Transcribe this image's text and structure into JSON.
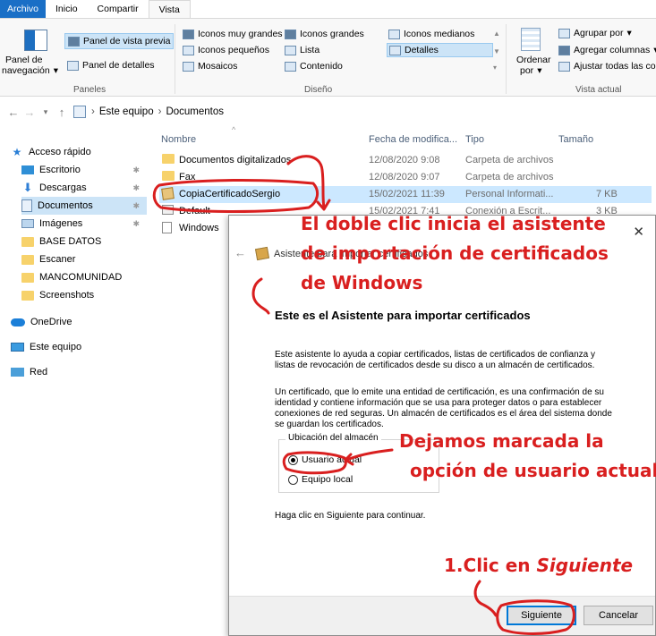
{
  "ribbon_tabs": [
    "Archivo",
    "Inicio",
    "Compartir",
    "Vista"
  ],
  "ribbon": {
    "panes": {
      "nav_pane": "Panel de",
      "nav_pane2": "navegación",
      "preview_pane": "Panel de vista previa",
      "details_pane": "Panel de detalles",
      "label": "Paneles"
    },
    "layout": {
      "items": [
        "Iconos muy grandes",
        "Iconos grandes",
        "Iconos medianos",
        "Iconos pequeños",
        "Lista",
        "Detalles",
        "Mosaicos",
        "Contenido"
      ],
      "label": "Diseño"
    },
    "current_view": {
      "sort": "Ordenar",
      "sort2": "por",
      "group_by": "Agrupar por",
      "add_columns": "Agregar columnas",
      "fit_columns": "Ajustar todas las colu",
      "label": "Vista actual"
    }
  },
  "address": {
    "crumbs": [
      "Este equipo",
      "Documentos"
    ]
  },
  "sidebar": {
    "items": [
      "Acceso rápido",
      "Escritorio",
      "Descargas",
      "Documentos",
      "Imágenes",
      "BASE DATOS",
      "Escaner",
      "MANCOMUNIDAD",
      "Screenshots",
      "OneDrive",
      "Este equipo",
      "Red"
    ],
    "pin": "✱"
  },
  "filelist": {
    "columns": [
      "Nombre",
      "Fecha de modifica...",
      "Tipo",
      "Tamaño"
    ],
    "rows": [
      {
        "name": "Documentos digitalizados",
        "date": "12/08/2020 9:08",
        "type": "Carpeta de archivos",
        "size": ""
      },
      {
        "name": "Fax",
        "date": "12/08/2020 9:07",
        "type": "Carpeta de archivos",
        "size": ""
      },
      {
        "name": "CopiaCertificadoSergio",
        "date": "15/02/2021 11:39",
        "type": "Personal Informati...",
        "size": "7 KB"
      },
      {
        "name": "Default",
        "date": "15/02/2021 7:41",
        "type": "Conexión a Escrit...",
        "size": "3 KB"
      },
      {
        "name": "Windows",
        "date": "",
        "type": "",
        "size": ""
      }
    ]
  },
  "dialog": {
    "title": "Asistente para importar certificados",
    "heading": "Este es el Asistente para importar certificados",
    "para1": "Este asistente lo ayuda a copiar certificados, listas de certificados de confianza y listas de revocación de certificados desde su disco a un almacén de certificados.",
    "para2": "Un certificado, que lo emite una entidad de certificación, es una confirmación de su identidad y contiene información que se usa para proteger datos o para establecer conexiones de red seguras. Un almacén de certificados es el área del sistema donde se guardan los certificados.",
    "store_legend": "Ubicación del almacén",
    "radio_current_user": "Usuario actual",
    "radio_local_machine": "Equipo local",
    "continue_text": "Haga clic en Siguiente para continuar.",
    "next_button": "Siguiente",
    "cancel_button": "Cancelar",
    "selected_store": "Usuario actual"
  },
  "annotations": {
    "double_click_1": "El doble clic inicia el asistente",
    "double_click_2": "de importación de certificados",
    "double_click_3": "de Windows",
    "leave_checked_1": "Dejamos marcada la",
    "leave_checked_2": "opción de usuario actual",
    "click_next_prefix": "1.Clic en ",
    "click_next_em": "Siguiente",
    "color": "#d91f1f"
  }
}
